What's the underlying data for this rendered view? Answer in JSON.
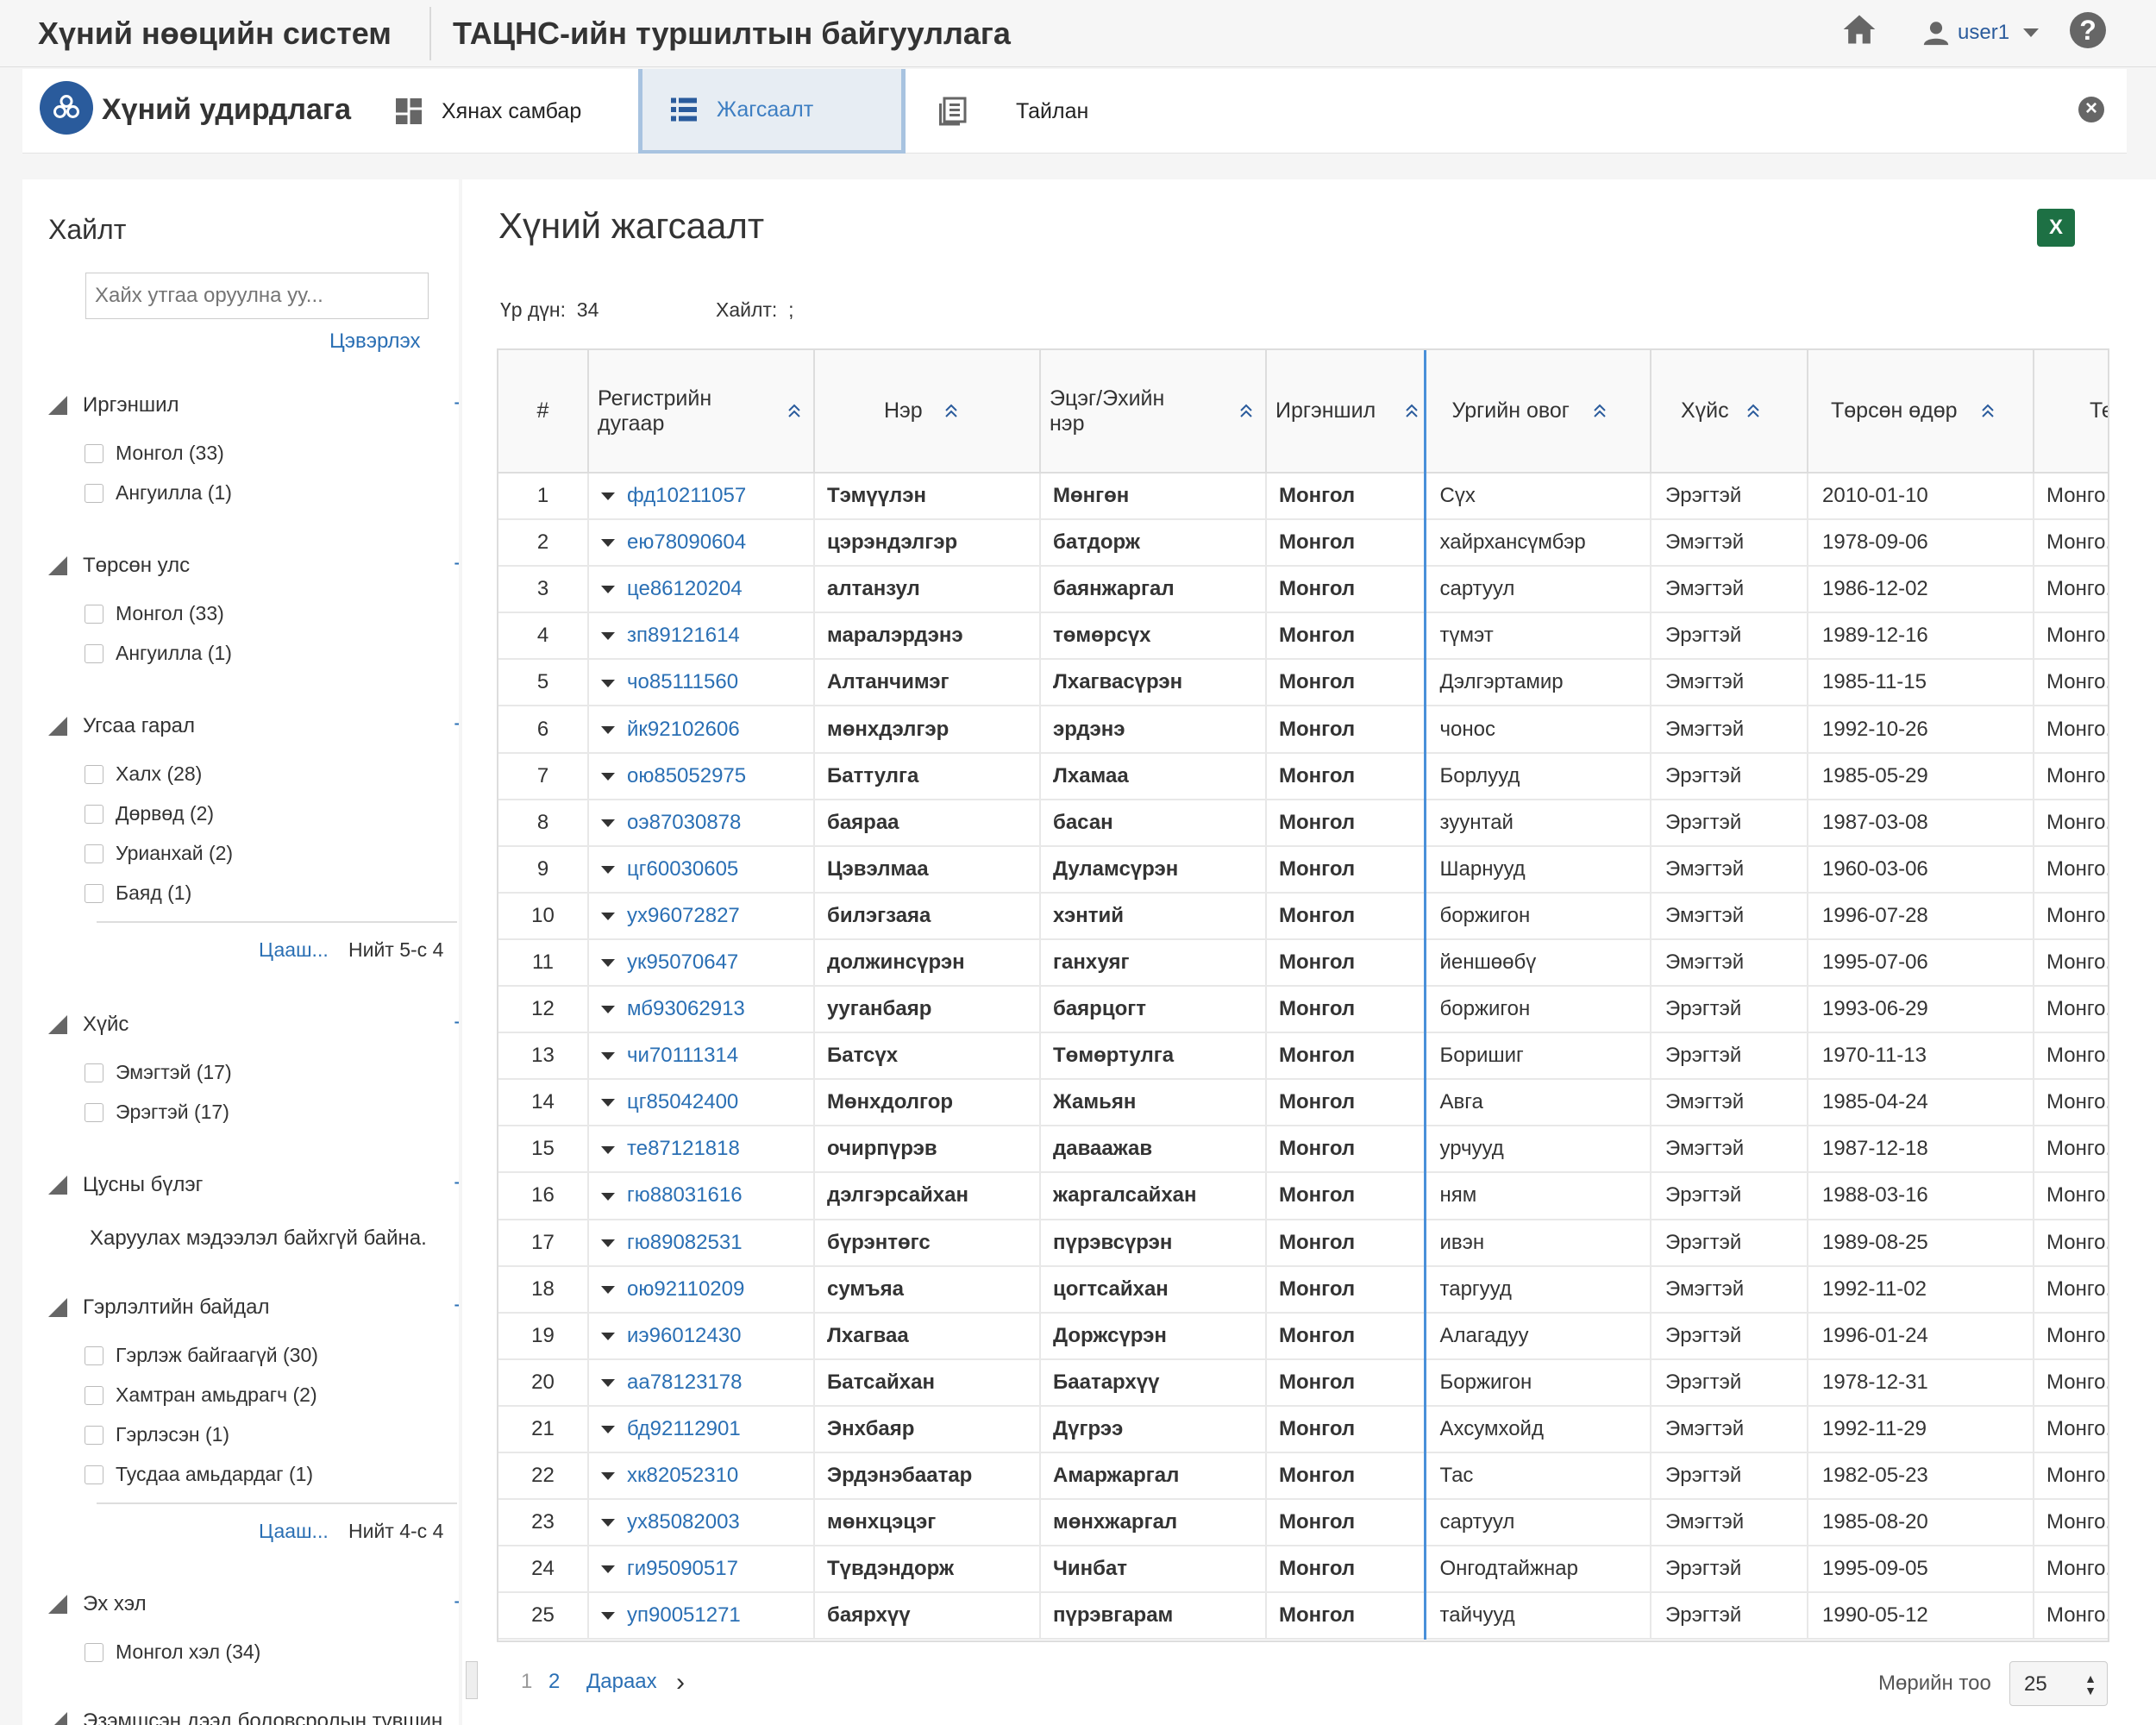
{
  "header": {
    "system_title": "Хүний нөөцийн систем",
    "org_title": "ТАЦНС-ийн туршилтын байгууллага",
    "username": "user1"
  },
  "nav": {
    "brand": "Хүний удирдлага",
    "tabs": [
      {
        "label": "Хянах самбар",
        "icon": "dashboard-icon"
      },
      {
        "label": "Жагсаалт",
        "icon": "list-icon"
      },
      {
        "label": "Тайлан",
        "icon": "report-icon"
      }
    ]
  },
  "sidebar": {
    "title": "Хайлт",
    "search_placeholder": "Хайх утгаа оруулна уу...",
    "clear_label": "Цэвэрлэх",
    "facets": [
      {
        "title": "Иргэншил",
        "items": [
          "Монгол (33)",
          "Ангуилла (1)"
        ]
      },
      {
        "title": "Төрсөн улс",
        "items": [
          "Монгол (33)",
          "Ангуилла (1)"
        ]
      },
      {
        "title": "Угсаа гарал",
        "items": [
          "Халх (28)",
          "Дөрвөд (2)",
          "Урианхай (2)",
          "Баяд (1)"
        ],
        "more": "Цааш...",
        "total": "Нийт 5-с 4"
      },
      {
        "title": "Хүйс",
        "items": [
          "Эмэгтэй (17)",
          "Эрэгтэй (17)"
        ]
      },
      {
        "title": "Цусны бүлэг",
        "note": "Харуулах мэдээлэл байхгүй байна."
      },
      {
        "title": "Гэрлэлтийн байдал",
        "items": [
          "Гэрлэж байгаагүй (30)",
          "Хамтран амьдрагч (2)",
          "Гэрлэсэн (1)",
          "Тусдаа амьдардаг (1)"
        ],
        "more": "Цааш...",
        "total": "Нийт 4-с 4"
      },
      {
        "title": "Эх хэл",
        "items": [
          "Монгол хэл (34)"
        ]
      },
      {
        "title": "Эзэмшсэн дээд боловсролын түвшин"
      }
    ]
  },
  "main": {
    "title": "Хүний жагсаалт",
    "result_label": "Үр дүн:",
    "result_count": "34",
    "search_label": "Хайлт:",
    "search_value": ";",
    "columns": [
      "#",
      "Регистрийн дугаар",
      "Нэр",
      "Эцэг/Эхийн нэр",
      "Иргэншил",
      "Ургийн овог",
      "Хүйс",
      "Төрсөн өдөр",
      "Те"
    ],
    "rows": [
      [
        "1",
        "фд10211057",
        "Тэмүүлэн",
        "Мөнгөн",
        "Монгол",
        "Сүх",
        "Эрэгтэй",
        "2010-01-10",
        "Монго..."
      ],
      [
        "2",
        "ею78090604",
        "цэрэндэлгэр",
        "батдорж",
        "Монгол",
        "хайрхансүмбэр",
        "Эмэгтэй",
        "1978-09-06",
        "Монго..."
      ],
      [
        "3",
        "це86120204",
        "алтанзул",
        "баянжаргал",
        "Монгол",
        "сартуул",
        "Эмэгтэй",
        "1986-12-02",
        "Монго..."
      ],
      [
        "4",
        "зп89121614",
        "маралэрдэнэ",
        "төмөрсүх",
        "Монгол",
        "түмэт",
        "Эрэгтэй",
        "1989-12-16",
        "Монго..."
      ],
      [
        "5",
        "чо85111560",
        "Алтанчимэг",
        "Лхагвасүрэн",
        "Монгол",
        "Дэлгэртамир",
        "Эмэгтэй",
        "1985-11-15",
        "Монго..."
      ],
      [
        "6",
        "йк92102606",
        "мөнхдэлгэр",
        "эрдэнэ",
        "Монгол",
        "чонос",
        "Эмэгтэй",
        "1992-10-26",
        "Монго..."
      ],
      [
        "7",
        "ою85052975",
        "Баттулга",
        "Лхамаа",
        "Монгол",
        "Борлууд",
        "Эрэгтэй",
        "1985-05-29",
        "Монго..."
      ],
      [
        "8",
        "оэ87030878",
        "баяраа",
        "басан",
        "Монгол",
        "зуунтай",
        "Эрэгтэй",
        "1987-03-08",
        "Монго..."
      ],
      [
        "9",
        "цг60030605",
        "Цэвэлмаа",
        "Дуламсүрэн",
        "Монгол",
        "Шарнууд",
        "Эмэгтэй",
        "1960-03-06",
        "Монго..."
      ],
      [
        "10",
        "ух96072827",
        "билэгзаяа",
        "хэнтий",
        "Монгол",
        "боржигон",
        "Эмэгтэй",
        "1996-07-28",
        "Монго..."
      ],
      [
        "11",
        "ук95070647",
        "должинсүрэн",
        "ганхуяг",
        "Монгол",
        "йеншөөбү",
        "Эмэгтэй",
        "1995-07-06",
        "Монго..."
      ],
      [
        "12",
        "мб93062913",
        "ууганбаяр",
        "баярцогт",
        "Монгол",
        "боржигон",
        "Эрэгтэй",
        "1993-06-29",
        "Монго..."
      ],
      [
        "13",
        "чи70111314",
        "Батсүх",
        "Төмөртулга",
        "Монгол",
        "Боришиг",
        "Эрэгтэй",
        "1970-11-13",
        "Монго..."
      ],
      [
        "14",
        "цг85042400",
        "Мөнхдолгор",
        "Жамьян",
        "Монгол",
        "Авга",
        "Эмэгтэй",
        "1985-04-24",
        "Монго..."
      ],
      [
        "15",
        "те87121818",
        "очирпүрэв",
        "даваажав",
        "Монгол",
        "урчууд",
        "Эмэгтэй",
        "1987-12-18",
        "Монго..."
      ],
      [
        "16",
        "гю88031616",
        "дэлгэрсайхан",
        "жаргалсайхан",
        "Монгол",
        "ням",
        "Эрэгтэй",
        "1988-03-16",
        "Монго..."
      ],
      [
        "17",
        "гю89082531",
        "бүрэнтөгс",
        "пүрэвсүрэн",
        "Монгол",
        "ивэн",
        "Эрэгтэй",
        "1989-08-25",
        "Монго..."
      ],
      [
        "18",
        "ою92110209",
        "сумъяа",
        "цогтсайхан",
        "Монгол",
        "таргууд",
        "Эмэгтэй",
        "1992-11-02",
        "Монго..."
      ],
      [
        "19",
        "иэ96012430",
        "Лхагваа",
        "Доржсүрэн",
        "Монгол",
        "Алагадуу",
        "Эрэгтэй",
        "1996-01-24",
        "Монго..."
      ],
      [
        "20",
        "аа78123178",
        "Батсайхан",
        "Баатархүү",
        "Монгол",
        "Боржигон",
        "Эрэгтэй",
        "1978-12-31",
        "Монго..."
      ],
      [
        "21",
        "бд92112901",
        "Энхбаяр",
        "Дүгрээ",
        "Монгол",
        "Ахсумхойд",
        "Эмэгтэй",
        "1992-11-29",
        "Монго..."
      ],
      [
        "22",
        "хк82052310",
        "Эрдэнэбаатар",
        "Амаржаргал",
        "Монгол",
        "Тас",
        "Эрэгтэй",
        "1982-05-23",
        "Монго..."
      ],
      [
        "23",
        "ух85082003",
        "мөнхцэцэг",
        "мөнхжаргал",
        "Монгол",
        "сартуул",
        "Эмэгтэй",
        "1985-08-20",
        "Монго..."
      ],
      [
        "24",
        "ги95090517",
        "Түвдэндорж",
        "Чинбат",
        "Монгол",
        "Онгодтайжнар",
        "Эрэгтэй",
        "1995-09-05",
        "Монго..."
      ],
      [
        "25",
        "уп90051271",
        "баярхүү",
        "пүрэвгарам",
        "Монгол",
        "тайчууд",
        "Эрэгтэй",
        "1990-05-12",
        "Монго..."
      ]
    ]
  },
  "pager": {
    "page1": "1",
    "page2": "2",
    "next": "Дараах",
    "rows_label": "Мөрийн тоо",
    "rows_value": "25"
  }
}
